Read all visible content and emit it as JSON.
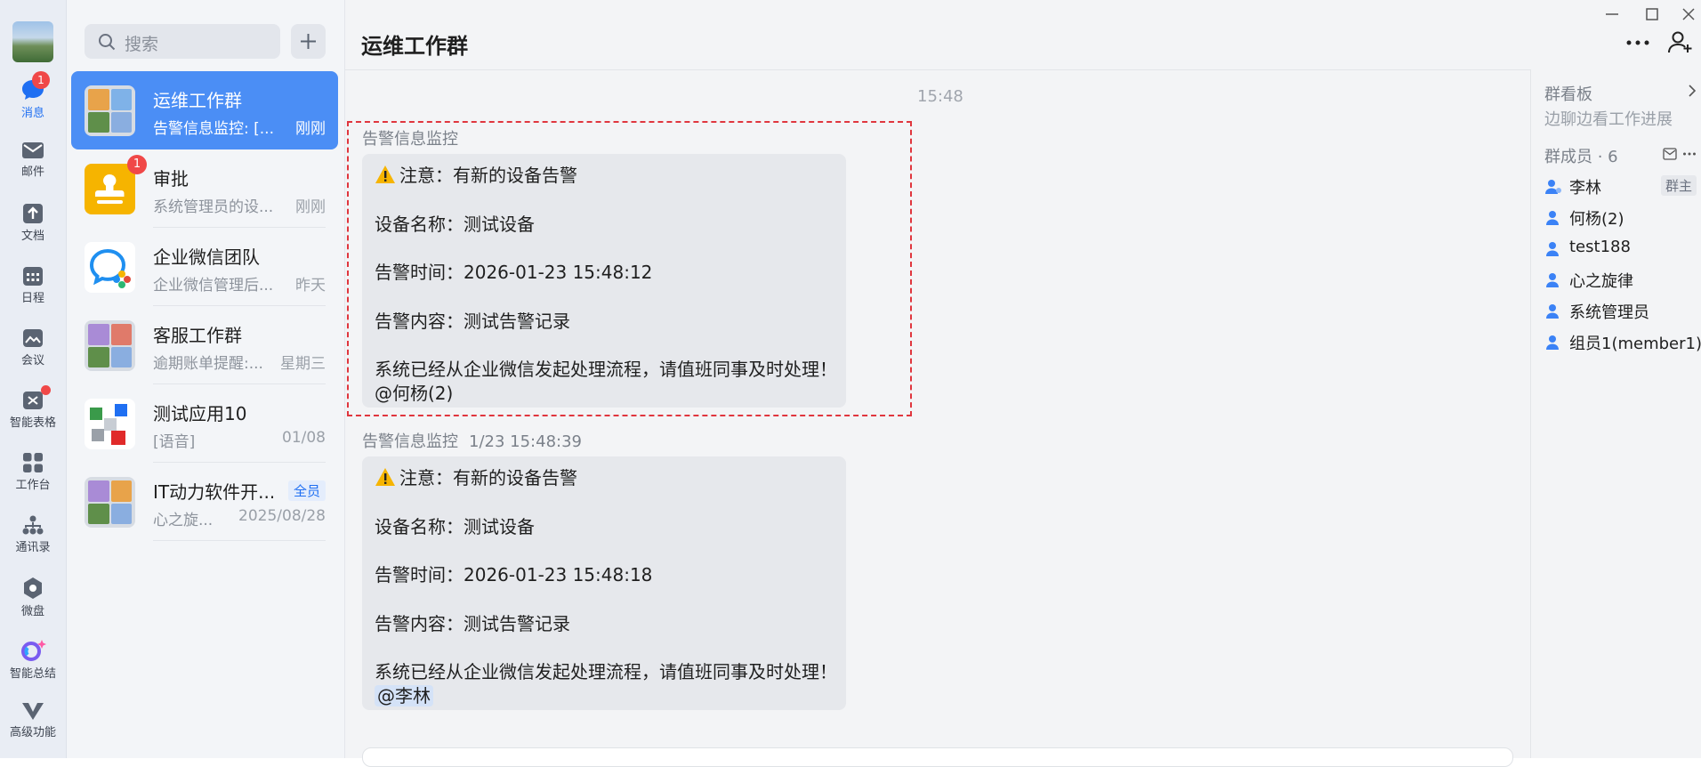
{
  "rail": {
    "items": [
      {
        "label": "消息",
        "badge": "1",
        "icon": "chat-bubble-icon"
      },
      {
        "label": "邮件",
        "icon": "mail-icon"
      },
      {
        "label": "文档",
        "icon": "document-icon"
      },
      {
        "label": "日程",
        "icon": "calendar-icon"
      },
      {
        "label": "会议",
        "icon": "meeting-icon"
      },
      {
        "label": "智能表格",
        "icon": "smart-sheet-icon"
      },
      {
        "label": "工作台",
        "icon": "workbench-icon"
      },
      {
        "label": "通讯录",
        "icon": "contacts-icon"
      },
      {
        "label": "微盘",
        "icon": "drive-icon"
      },
      {
        "label": "智能总结",
        "icon": "ai-summary-icon"
      },
      {
        "label": "高级功能",
        "icon": "premium-icon"
      }
    ]
  },
  "search": {
    "placeholder": "搜索"
  },
  "conversations": [
    {
      "name": "运维工作群",
      "preview": "告警信息监控: [...",
      "time": "刚刚"
    },
    {
      "name": "审批",
      "preview": "系统管理员的设...",
      "time": "刚刚",
      "badge": "1"
    },
    {
      "name": "企业微信团队",
      "preview": "企业微信管理后...",
      "time": "昨天"
    },
    {
      "name": "客服工作群",
      "preview": "逾期账单提醒:...",
      "time": "星期三"
    },
    {
      "name": "测试应用10",
      "preview": "[语音]",
      "time": "01/08"
    },
    {
      "name": "IT动力软件开...",
      "preview": "心之旋...",
      "time": "2025/08/28",
      "tag": "全员"
    }
  ],
  "chat": {
    "title": "运维工作群",
    "time_divider": "15:48",
    "messages": [
      {
        "sender": "告警信息监控",
        "timestamp": "",
        "lines": [
          "注意：有新的设备告警",
          "设备名称：测试设备",
          "告警时间：2026-01-23 15:48:12",
          "告警内容：测试告警记录",
          "系统已经从企业微信发起处理流程，请值班同事及时处理！"
        ],
        "mention": "@何杨(2)"
      },
      {
        "sender": "告警信息监控",
        "timestamp": "1/23 15:48:39",
        "lines": [
          "注意：有新的设备告警",
          "设备名称：测试设备",
          "告警时间：2026-01-23 15:48:18",
          "告警内容：测试告警记录",
          "系统已经从企业微信发起处理流程，请值班同事及时处理！"
        ],
        "mention": "@李林"
      }
    ]
  },
  "panel": {
    "board_title": "群看板",
    "board_sub": "边聊边看工作进展",
    "members_title": "群成员 · 6",
    "members": [
      {
        "name": "李林",
        "role": "群主"
      },
      {
        "name": "何杨(2)"
      },
      {
        "name": "test188"
      },
      {
        "name": "心之旋律"
      },
      {
        "name": "系统管理员"
      },
      {
        "name": "组员1(member1)"
      }
    ]
  },
  "colors": {
    "accent": "#4b8ef5",
    "badge": "#f04848",
    "highlight_border": "#e0363e"
  }
}
